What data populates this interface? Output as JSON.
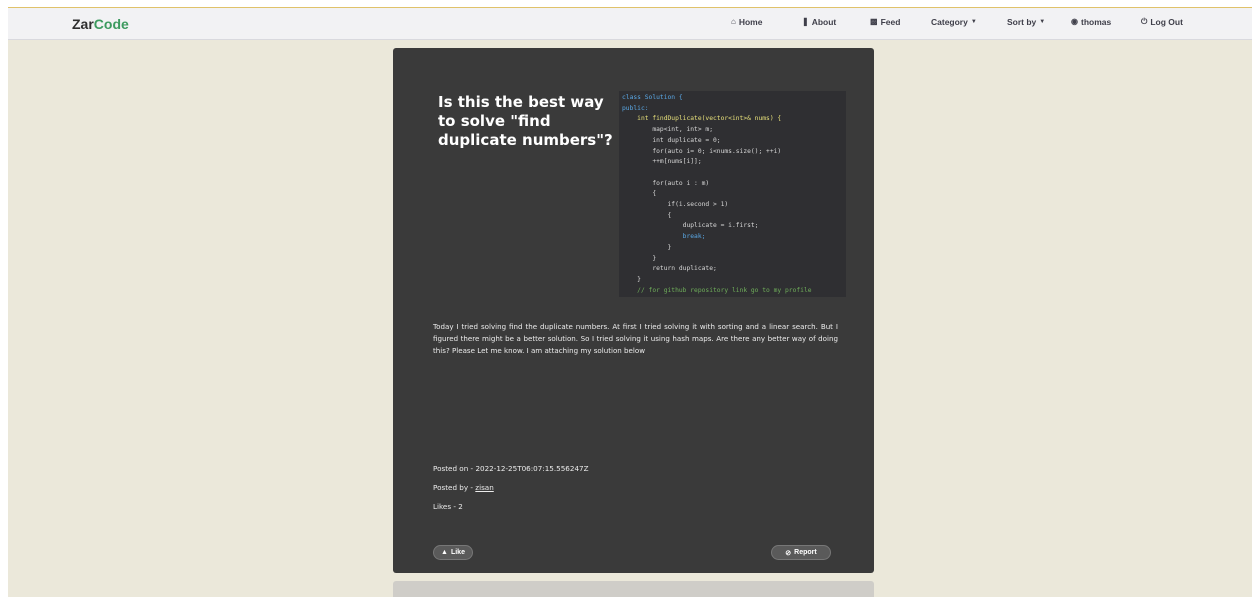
{
  "brand": {
    "part1": "Zar",
    "part2": "Code"
  },
  "nav": {
    "home": "Home",
    "about": "About",
    "feed": "Feed",
    "category": "Category",
    "sort_by": "Sort by",
    "user": "thomas",
    "logout": "Log Out"
  },
  "post": {
    "title": "Is this the best way to solve \"find duplicate numbers\"?",
    "body": "Today I tried solving find the duplicate numbers. At first I tried solving it with sorting and a linear search. But I figured there might be a better solution. So I tried solving it using hash maps. Are there any better way of doing this? Please Let me know. I am attaching my solution below",
    "posted_on_label": "Posted on - ",
    "posted_on": "2022-12-25T06:07:15.556247Z",
    "posted_by_label": "Posted by - ",
    "author": "zisan",
    "likes_label": "Likes - ",
    "likes": "2"
  },
  "buttons": {
    "like": "Like",
    "report": "Report"
  },
  "code_image": {
    "lines": [
      "class Solution {",
      "public:",
      "    int findDuplicate(vector<int>& nums) {",
      "        map<int, int> m;",
      "        int duplicate = 0;",
      "        for(auto i= 0; i<nums.size(); ++i)",
      "        ++m[nums[i]];",
      "",
      "        for(auto i : m)",
      "        {",
      "            if(i.second > 1)",
      "            {",
      "                duplicate = i.first;",
      "                break;",
      "            }",
      "        }",
      "        return duplicate;",
      "    }",
      "    // for github repository link go to my profile"
    ]
  },
  "icons": {
    "home": "home-icon",
    "about": "info-icon",
    "feed": "feed-icon",
    "user": "user-icon",
    "logout": "power-icon",
    "like": "thumbs-up-icon",
    "report": "ban-icon"
  },
  "colors": {
    "page_bg": "#ebe8da",
    "navbar_bg": "#f2f2f4",
    "card_bg": "#3a3a3a",
    "brand_accent": "#3c9a5f"
  }
}
